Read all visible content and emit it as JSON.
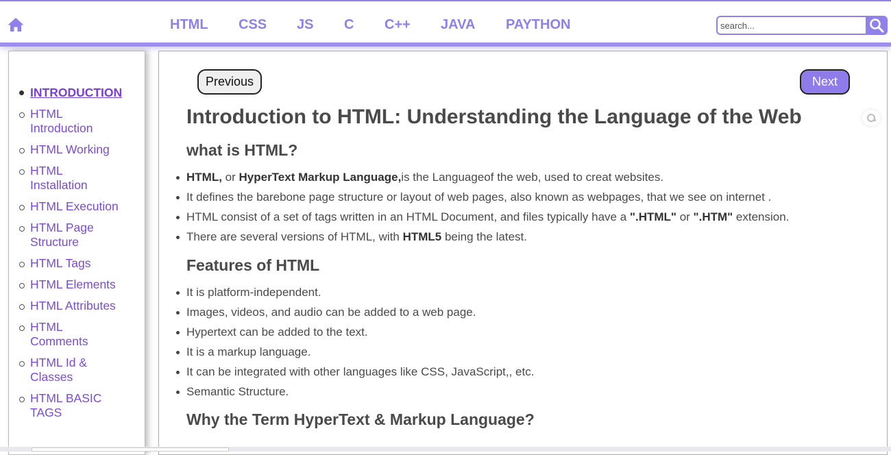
{
  "header": {
    "home_icon": "home-icon",
    "nav": [
      "HTML",
      "CSS",
      "JS",
      "C",
      "C++",
      "JAVA",
      "PAYTHON"
    ],
    "search": {
      "placeholder": "search...",
      "icon": "search-icon"
    },
    "accent": "#8f80ea"
  },
  "sidebar": {
    "items": [
      {
        "label": "INTRODUCTION",
        "active": true
      },
      {
        "label": "HTML Introduction"
      },
      {
        "label": "HTML Working"
      },
      {
        "label": "HTML Installation"
      },
      {
        "label": "HTML Execution"
      },
      {
        "label": "HTML Page Structure"
      },
      {
        "label": "HTML Tags"
      },
      {
        "label": "HTML Elements"
      },
      {
        "label": "HTML Attributes"
      },
      {
        "label": "HTML Comments"
      },
      {
        "label": "HTML Id & Classes"
      },
      {
        "label": "HTML BASIC TAGS"
      }
    ]
  },
  "main": {
    "prev_label": "Previous",
    "next_label": "Next",
    "title": "Introduction to HTML: Understanding the Language of the Web",
    "what": {
      "heading": "what is HTML?",
      "b1_bold1": "HTML,",
      "b1_t1": " or ",
      "b1_bold2": "HyperText Markup Language,",
      "b1_t2": "is the Languageof the web, used to creat websites.",
      "b2": "It defines the barebone page structure or layout of web pages, also known as webpages, that we see on internet .",
      "b3_t1": "HTML consist of a set of tags written in an HTML Document, and files typically have a ",
      "b3_bold1": "\".HTML\"",
      "b3_t2": " or ",
      "b3_bold2": "\".HTM\"",
      "b3_t3": " extension.",
      "b4_t1": "There are several versions of HTML, with ",
      "b4_bold": "HTML5",
      "b4_t2": " being the latest."
    },
    "features": {
      "heading": "Features of HTML",
      "items": [
        "It is platform-independent.",
        "Images, videos, and audio can be added to a web page.",
        "Hypertext can be added to the text.",
        "It is a markup language.",
        "It can be integrated with other languages like CSS, JavaScript,, etc.",
        "Semantic Structure."
      ]
    },
    "why_heading": "Why the Term HyperText & Markup Language?"
  }
}
